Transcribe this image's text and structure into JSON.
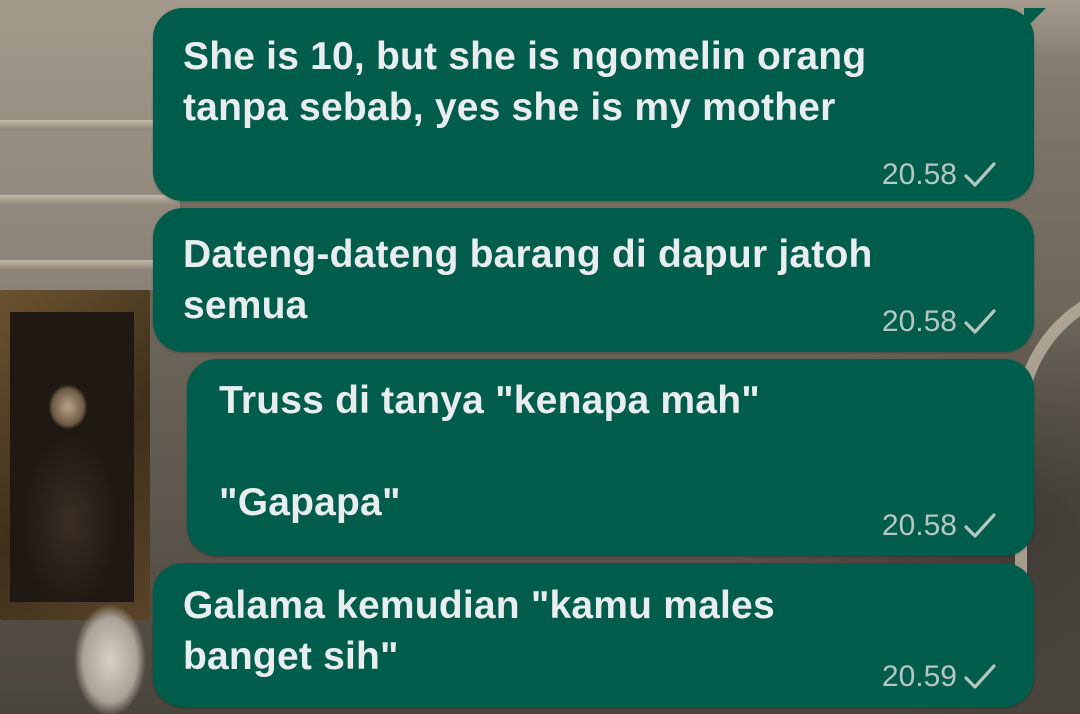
{
  "chat": {
    "messages": [
      {
        "text": "She is 10, but she is ngomelin orang\ntanpa sebab, yes she is my mother",
        "time": "20.58",
        "status_icon": "single-check-icon"
      },
      {
        "text": "Dateng-dateng barang di dapur jatoh\nsemua",
        "time": "20.58",
        "status_icon": "single-check-icon"
      },
      {
        "text": "Truss di tanya \"kenapa mah\"\n\n\"Gapapa\"",
        "time": "20.58",
        "status_icon": "single-check-icon"
      },
      {
        "text": "Galama kemudian \"kamu males\nbanget sih\"",
        "time": "20.59",
        "status_icon": "single-check-icon"
      }
    ]
  },
  "colors": {
    "bubble_outgoing": "#005c4b",
    "message_text": "#e9edef",
    "meta_text": "#b6c6c2"
  }
}
